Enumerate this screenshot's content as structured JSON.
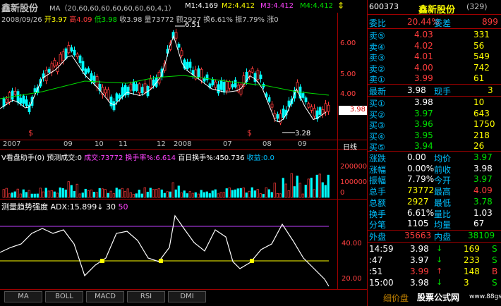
{
  "header": {
    "title": "鑫新股份",
    "ma_prefix": "MA（20,60,60,60,60,60,60,60,4,1）",
    "m1": "M1:4.169",
    "m2": "M2:4.412",
    "m3": "M3:4.412",
    "m4": "M4:4.412"
  },
  "quote_line": {
    "date": "2008/09/26",
    "open": "开3.97",
    "high": "高4.09",
    "low": "低3.98",
    "close": "收3.98",
    "volume": "量73772",
    "amount": "额2927",
    "turnover": "换6.61%",
    "amplitude": "振7.79%",
    "rise": "涨0"
  },
  "price_axis": {
    "ticks": [
      "6.00",
      "5.00",
      "4.00"
    ],
    "current_price": "3.98",
    "high_label": "6.51",
    "low_label": "3.28"
  },
  "date_axis": {
    "labels": [
      "2007",
      "09",
      "10",
      "11",
      "12",
      "2008",
      "07",
      "08",
      "09"
    ],
    "period": "日线"
  },
  "volume_panel": {
    "title": "V看盘助手(0)",
    "forecast": "预测成交:0",
    "trade_label": "成交:",
    "trade_value": "73772",
    "turnover_label": "换手率%:",
    "turnover_value": "6.614",
    "hundred_label": "百日换手%:",
    "hundred_value": "450.736",
    "earnings_label": "收益:",
    "earnings_value": "0.0",
    "axis_ticks": [
      "200000",
      "100000",
      "0"
    ]
  },
  "adx_panel": {
    "title": "测量趋势强度",
    "adx": "ADX:15.899",
    "v1": "30",
    "v2": "50",
    "axis_ticks": [
      "40.00",
      "20.00"
    ]
  },
  "bottom_tabs": [
    "MA",
    "BOLL",
    "MACD",
    "RSI",
    "DMI"
  ],
  "side": {
    "code": "600373",
    "name": "鑫新股份",
    "count": "(329)",
    "weibi_label": "委比",
    "weibi_value": "20.44%",
    "weicha_label": "委差",
    "weicha_value": "899",
    "asks": [
      {
        "label": "卖⑤",
        "price": "4.03",
        "vol": "331"
      },
      {
        "label": "卖④",
        "price": "4.02",
        "vol": "56"
      },
      {
        "label": "卖③",
        "price": "4.01",
        "vol": "549"
      },
      {
        "label": "卖②",
        "price": "4.00",
        "vol": "742"
      },
      {
        "label": "卖①",
        "price": "3.99",
        "vol": "61"
      }
    ],
    "last_label": "最新",
    "last_value": "3.98",
    "cur_label": "现手",
    "cur_value": "3",
    "bids": [
      {
        "label": "买①",
        "price": "3.98",
        "vol": "10"
      },
      {
        "label": "买②",
        "price": "3.97",
        "vol": "643"
      },
      {
        "label": "买③",
        "price": "3.96",
        "vol": "1750"
      },
      {
        "label": "买④",
        "price": "3.95",
        "vol": "218"
      },
      {
        "label": "买⑤",
        "price": "3.94",
        "vol": "26"
      }
    ],
    "stats": [
      {
        "l1": "涨跌",
        "v1": "0.00",
        "l2": "均价",
        "v2": "3.97"
      },
      {
        "l1": "涨幅",
        "v1": "0.00%",
        "l2": "前收",
        "v2": "3.98"
      },
      {
        "l1": "振幅",
        "v1": "7.79%",
        "l2": "今开",
        "v2": "3.97"
      },
      {
        "l1": "总手",
        "v1": "73772",
        "l2": "最高",
        "v2": "4.09"
      },
      {
        "l1": "总额",
        "v1": "2927",
        "l2": "最低",
        "v2": "3.78"
      },
      {
        "l1": "换手",
        "v1": "6.61%",
        "l2": "量比",
        "v2": "1.03"
      },
      {
        "l1": "分笔",
        "v1": "1105",
        "l2": "均量",
        "v2": "67"
      }
    ],
    "outer_label": "外盘",
    "outer_value": "35663",
    "inner_label": "内盘",
    "inner_value": "38109",
    "ticks": [
      {
        "time": "14:59",
        "price": "3.98",
        "vol": "169",
        "side": "S"
      },
      {
        "time": ":47",
        "price": "3.97",
        "vol": "233",
        "side": "S"
      },
      {
        "time": ":51",
        "price": "3.99",
        "vol": "148",
        "side": "B"
      },
      {
        "time": "15:00",
        "price": "3.98",
        "vol": "3",
        "side": "S"
      }
    ],
    "footer": "细价盘",
    "watermark": "股票公式网",
    "watermark_url": "www.88gs.com"
  }
}
